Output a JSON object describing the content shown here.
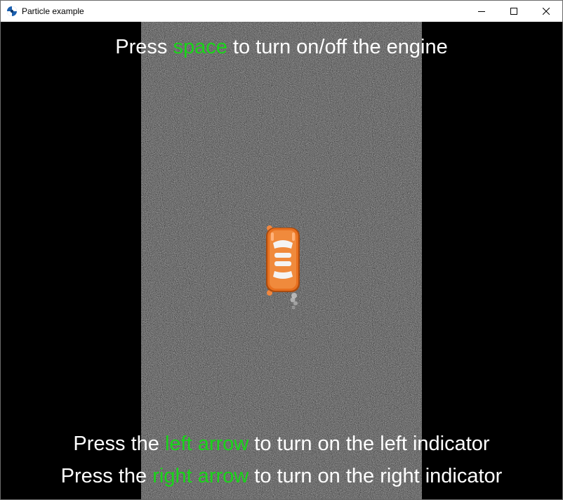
{
  "window": {
    "title": "Particle example",
    "app_icon": "app-logo-icon",
    "controls": [
      "minimize-icon",
      "maximize-icon",
      "close-icon"
    ]
  },
  "hud": {
    "engine": {
      "prefix": "Press ",
      "key": "space",
      "suffix": " to turn on/off the engine"
    },
    "left": {
      "prefix": "Press the ",
      "key": "left arrow",
      "suffix": " to turn on the left indicator"
    },
    "right": {
      "prefix": "Press the ",
      "key": "right arrow",
      "suffix": " to turn on the right indicator"
    }
  },
  "colors": {
    "key_highlight": "#19d419",
    "text": "#ffffff",
    "road": "#4a4a4a",
    "car_body": "#e8701f",
    "background": "#000000"
  },
  "scene": {
    "sprites": [
      "car-sprite",
      "exhaust-smoke"
    ]
  }
}
